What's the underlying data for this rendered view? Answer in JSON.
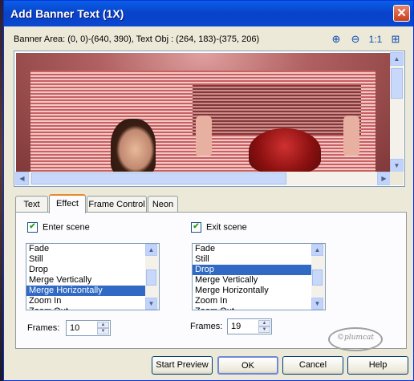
{
  "window": {
    "title": "Add Banner Text (1X)",
    "close_label": "✕"
  },
  "info": "Banner Area: (0, 0)-(640, 390), Text Obj : (264, 183)-(375, 206)",
  "toolbar": {
    "zoom_in": "⊕",
    "zoom_out": "⊖",
    "actual_size": "1:1",
    "fit": "⊞"
  },
  "tabs": [
    "Text",
    "Effect",
    "Frame Control",
    "Neon"
  ],
  "active_tab": "Effect",
  "enter": {
    "label": "Enter scene",
    "checked": true,
    "items": [
      "Fade",
      "Still",
      "Drop",
      "Merge Vertically",
      "Merge Horizontally",
      "Zoom In",
      "Zoom Out"
    ],
    "selected": "Merge Horizontally",
    "frames_label": "Frames:",
    "frames": "10"
  },
  "exit": {
    "label": "Exit scene",
    "checked": true,
    "items": [
      "Fade",
      "Still",
      "Drop",
      "Merge Vertically",
      "Merge Horizontally",
      "Zoom In",
      "Zoom Out"
    ],
    "selected": "Drop",
    "frames_label": "Frames:",
    "frames": "19"
  },
  "logo_text": "©plumcat",
  "buttons": {
    "start_preview": "Start Preview",
    "ok": "OK",
    "cancel": "Cancel",
    "help": "Help"
  },
  "colors": {
    "titlebar": "#0a5fe8",
    "selection": "#316ac5",
    "tab_accent": "#e68b2c"
  }
}
